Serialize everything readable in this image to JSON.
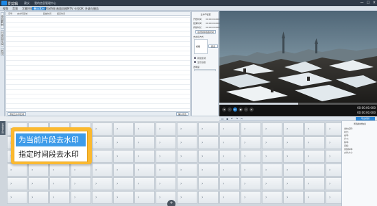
{
  "titlebar": {
    "app_name": "爱剪辑",
    "links": [
      "建议",
      "我的信息管理中心"
    ],
    "controls": [
      "—",
      "□",
      "×"
    ]
  },
  "menu": {
    "items": [
      "视频",
      "音频",
      "字幕特效",
      "叠加素材",
      "转场特效",
      "画面风格",
      "MTV",
      "卡拉OK",
      "升级与服务"
    ],
    "active_index": 3
  },
  "left_tabs": [
    "添加素材",
    "已添加片段",
    "水印"
  ],
  "list": {
    "columns": [
      "序号",
      "去水印区域",
      "起始时间",
      "结束时间"
    ],
    "add_button": "添加去水印区域",
    "ok_button": "确认修改"
  },
  "settings": {
    "title": "去水印设置",
    "start_label": "开始时间",
    "start_value": "00:00:00.000",
    "end_label": "结束时间",
    "end_value": "00:00:00.000",
    "length_label": "持续时长",
    "length_value": "00:00:00.000",
    "pick_button": "在视频中截取时间",
    "mode_label": "去水印方式",
    "mode_value": "模糊",
    "strength_label": "强度",
    "custom_button": "预览",
    "check1": "新建区域",
    "check2": "显示边框",
    "opacity_label": "透明度"
  },
  "player": {
    "time_total": "00:00:00.000",
    "time_current": "00:00:00.000",
    "progress": 0.5
  },
  "toolbar2": {
    "export_label": "导出视频",
    "icons": [
      "folder-icon",
      "save-icon",
      "undo-icon",
      "redo-icon",
      "cut-icon"
    ]
  },
  "timeline": {
    "side_label": "已添加片段"
  },
  "right_info": {
    "title": "所选素材信息",
    "rows": [
      "素材名称:",
      "时长:",
      "帧率:",
      "尺寸:",
      "码率:",
      "音频:",
      "音频码率:",
      "文件大小:"
    ]
  },
  "popup": {
    "items": [
      "为当前片段去水印",
      "指定时间段去水印"
    ],
    "selected_index": 0
  },
  "zoom_icon": "plus-icon"
}
